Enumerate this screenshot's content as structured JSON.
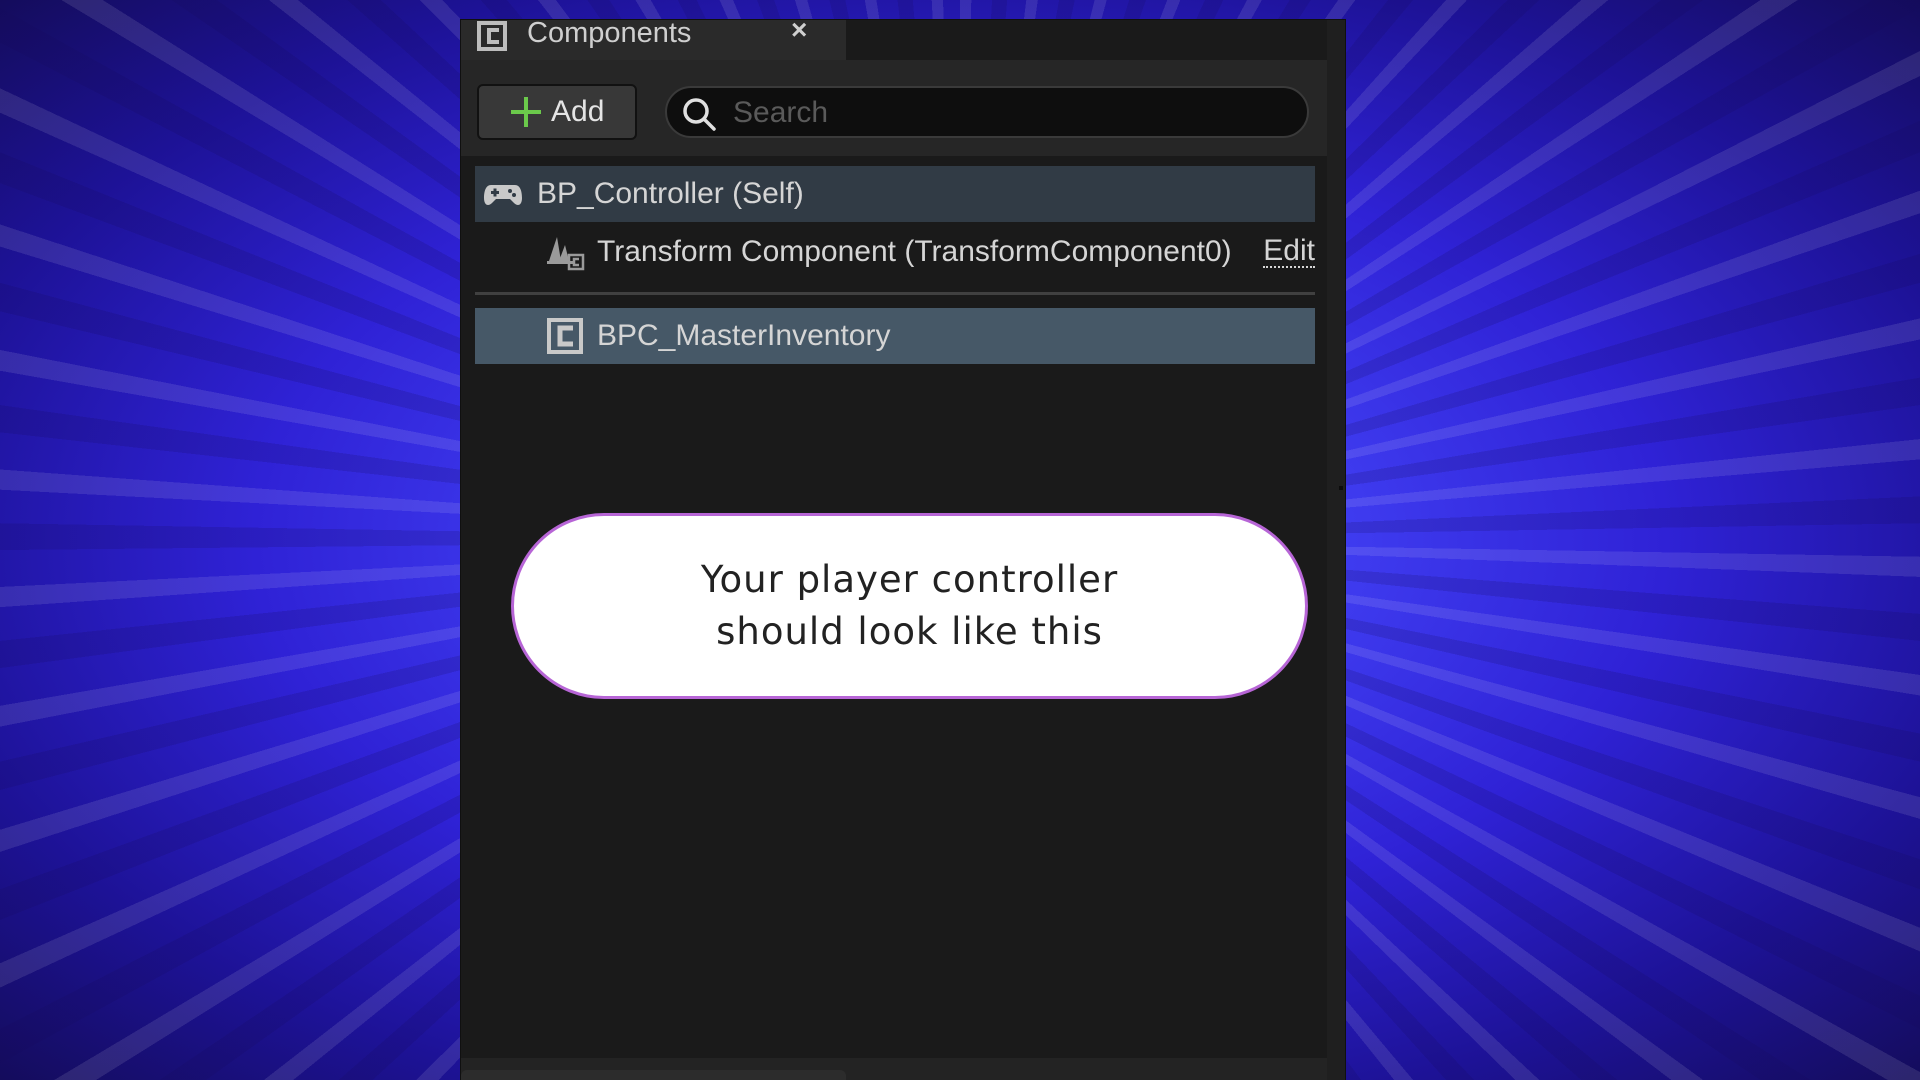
{
  "panel": {
    "tab": {
      "label": "Components",
      "close_symbol": "×",
      "icon": "component-icon"
    },
    "toolbar": {
      "add_label": "Add",
      "search_placeholder": "Search",
      "search_value": ""
    },
    "tree": [
      {
        "label": "BP_Controller (Self)",
        "icon": "gamepad-icon"
      },
      {
        "label": "Transform Component (TransformComponent0)",
        "icon": "transform-icon",
        "action": "Edit"
      },
      {
        "label": "BPC_MasterInventory",
        "icon": "component-icon",
        "selected": true
      }
    ]
  },
  "callout": {
    "line1": "Your player controller",
    "line2": "should look like this",
    "border_color": "#b765d6"
  },
  "colors": {
    "background_accent": "#3f3cf0",
    "panel_bg": "#1a1a1a",
    "selected_row": "#465867",
    "self_row": "#313b45",
    "add_plus": "#6bc94b"
  }
}
